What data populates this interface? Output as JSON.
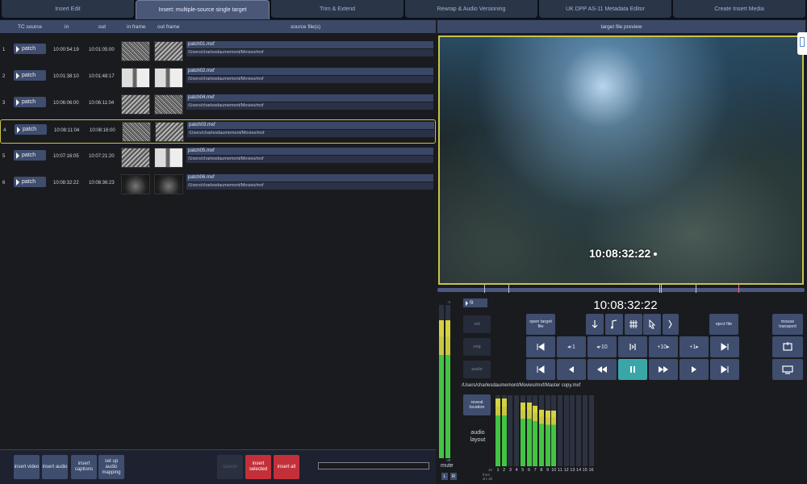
{
  "tabs": [
    {
      "label": "Insert Edit",
      "active": false
    },
    {
      "label": "Insert: multiple-source single target",
      "active": true
    },
    {
      "label": "Trim & Extend",
      "active": false
    },
    {
      "label": "Rewrap & Audio Versioning",
      "active": false
    },
    {
      "label": "UK DPP AS-11 Metadata Editor",
      "active": false
    },
    {
      "label": "Create Insert Media",
      "active": false
    }
  ],
  "columns": {
    "tc_source": "TC source",
    "in": "in",
    "out": "out",
    "in_frame": "in frame",
    "out_frame": "out frame",
    "source_files": "source file(s)"
  },
  "rows": [
    {
      "num": "1",
      "patch": "patch",
      "tc_in": "10:00:54:19",
      "tc_out": "10:01:05:00",
      "file": "patch01.mxf",
      "path": "/Users/charlesdaumemont/Movies/mxf",
      "selected": false
    },
    {
      "num": "2",
      "patch": "patch",
      "tc_in": "10:01:38:10",
      "tc_out": "10:01:48:17",
      "file": "patch02.mxf",
      "path": "/Users/charlesdaumemont/Movies/mxf",
      "selected": false
    },
    {
      "num": "3",
      "patch": "patch",
      "tc_in": "10:06:06:00",
      "tc_out": "10:06:11:04",
      "file": "patch04.mxf",
      "path": "/Users/charlesdaumemont/Movies/mxf",
      "selected": false
    },
    {
      "num": "4",
      "patch": "patch",
      "tc_in": "10:08:11:04",
      "tc_out": "10:08:16:00",
      "file": "patch03.mxf",
      "path": "/Users/charlesdaumemont/Movies/mxf",
      "selected": true
    },
    {
      "num": "5",
      "patch": "patch",
      "tc_in": "10:07:16:05",
      "tc_out": "10:07:21:20",
      "file": "patch05.mxf",
      "path": "/Users/charlesdaumemont/Movies/mxf",
      "selected": false
    },
    {
      "num": "6",
      "patch": "patch",
      "tc_in": "10:08:32:22",
      "tc_out": "10:08:36:23",
      "file": "patch06.mxf",
      "path": "/Users/charlesdaumemont/Movies/mxf",
      "selected": false
    }
  ],
  "bottom_buttons": {
    "insert_video": "insert video",
    "insert_audio": "insert audio",
    "insert_captions": "insert captions",
    "setup_audio_mapping": "set up audio mapping",
    "cancel": "cancel",
    "insert_selected": "insert selected",
    "insert_all": "insert all"
  },
  "preview": {
    "header": "target file preview",
    "timecode": "10:08:32:22"
  },
  "controls": {
    "fit": "fit",
    "timecode": "10:08:32:22",
    "open_target_file": "open target file",
    "eject_file": "eject file",
    "mouse_transport": "mouse transport",
    "step_back_1": "-1",
    "step_back_10": "-10",
    "step_fwd_10": "+10",
    "step_fwd_1": "+1",
    "side_vid": "vid",
    "side_orig": "orig",
    "side_audio": "audio",
    "file_path": "/Users/charlesdaumemont/Movies/mxf/Master copy.mxf",
    "reveal_location": "reveal location",
    "audio_layout": "audio layout",
    "mute": "mute",
    "L": "L",
    "R": "R",
    "meter_top": "-2",
    "meter_bottom": "-48",
    "ch_left_top": "10",
    "ch_left_bottom": "from src all",
    "channels": [
      "1",
      "2",
      "3",
      "4",
      "5",
      "6",
      "7",
      "8",
      "9",
      "10",
      "11",
      "12",
      "13",
      "14",
      "15",
      "16"
    ]
  },
  "colors": {
    "accent_yellow": "#c7c34a",
    "button_blue": "#3f4d6e",
    "insert_red": "#c4303a",
    "pause_teal": "#3aa6a8",
    "meter_green": "#43c443"
  },
  "meter_levels": {
    "master_L": 0.9,
    "master_R": 0.9,
    "channels": [
      0.96,
      0.96,
      0,
      0,
      0.9,
      0.9,
      0.85,
      0.8,
      0.78,
      0.78,
      0,
      0,
      0,
      0,
      0,
      0
    ]
  }
}
